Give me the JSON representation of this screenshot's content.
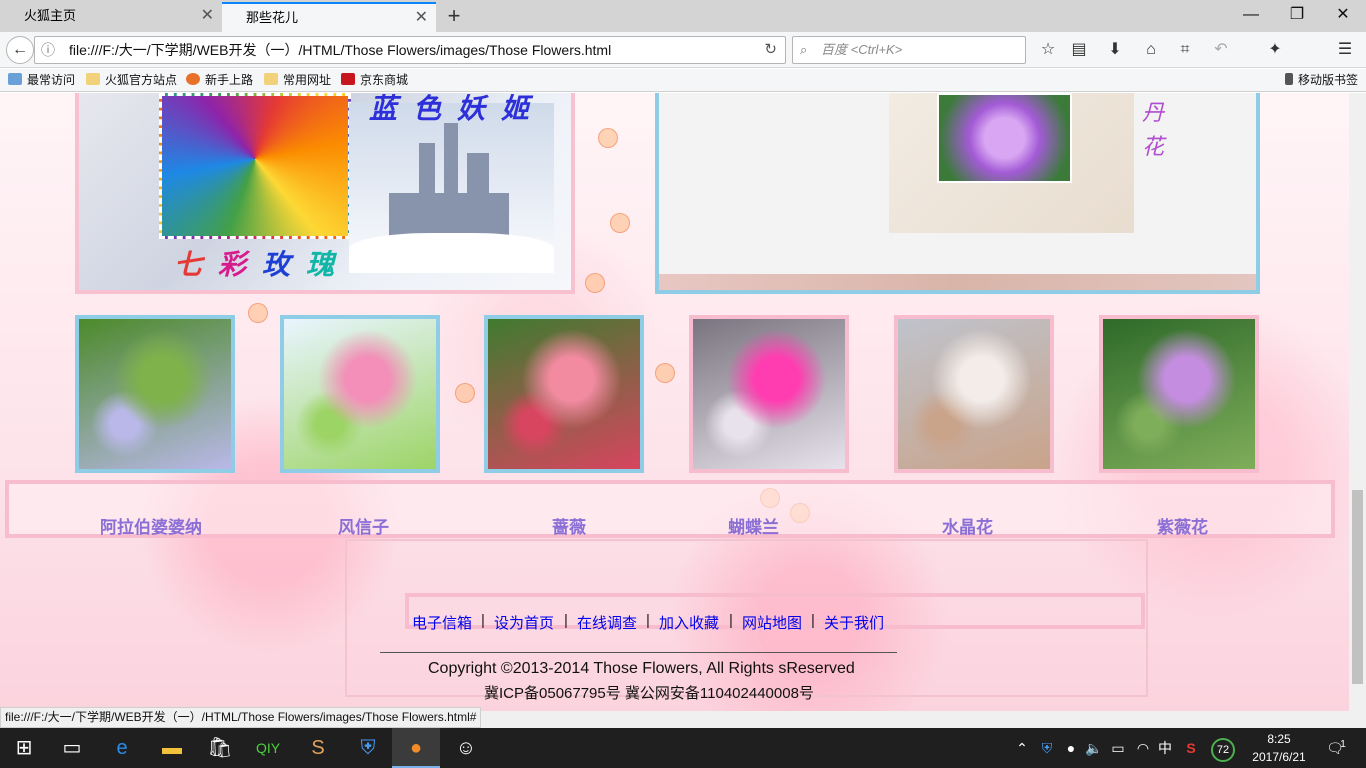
{
  "browser": {
    "tabs": [
      {
        "label": "火狐主页",
        "active": false
      },
      {
        "label": "那些花儿",
        "active": true
      }
    ],
    "url": "file:///F:/大一/下学期/WEB开发（一）/HTML/Those Flowers/images/Those Flowers.html",
    "search_placeholder": "百度 <Ctrl+K>",
    "bookmarks": [
      {
        "label": "最常访问",
        "icon": "star-folder-icon"
      },
      {
        "label": "火狐官方站点",
        "icon": "folder-icon"
      },
      {
        "label": "新手上路",
        "icon": "firefox-icon"
      },
      {
        "label": "常用网址",
        "icon": "folder-icon"
      },
      {
        "label": "京东商城",
        "icon": "jd-icon"
      }
    ],
    "mobile_bookmarks": "移动版书签",
    "status_url": "file:///F:/大一/下学期/WEB开发（一）/HTML/Those Flowers/images/Those Flowers.html#"
  },
  "page": {
    "banner_left": {
      "title_top": "蓝色妖姬",
      "title_bottom_chars": [
        "七",
        "彩",
        "玫",
        "瑰"
      ],
      "title_bottom_colors": [
        "#e53935",
        "#d81b8c",
        "#1e3fd6",
        "#12b6a6"
      ]
    },
    "banner_right": {
      "title_chars": [
        "丹",
        "花"
      ]
    },
    "flowers": [
      {
        "name": "阿拉伯婆婆纳",
        "border": "#8fcde6",
        "colors": [
          "#4c8a2a",
          "#7fb24a",
          "#b9b8e8"
        ]
      },
      {
        "name": "风信子",
        "border": "#8fcde6",
        "colors": [
          "#e9f5ff",
          "#f38fb8",
          "#9dd466"
        ]
      },
      {
        "name": "蔷薇",
        "border": "#8fcde6",
        "colors": [
          "#3f7b2f",
          "#f28aa0",
          "#d7455f"
        ]
      },
      {
        "name": "蝴蝶兰",
        "border": "#f7bccd",
        "colors": [
          "#7a7480",
          "#ff3db0",
          "#e8e2ec"
        ]
      },
      {
        "name": "水晶花",
        "border": "#f7bccd",
        "colors": [
          "#bfc3cc",
          "#f3ece8",
          "#c9a38a"
        ]
      },
      {
        "name": "紫薇花",
        "border": "#f7bccd",
        "colors": [
          "#2f6a2a",
          "#c58de0",
          "#7fae5a"
        ]
      }
    ],
    "footer_links": [
      "电子信箱",
      "设为首页",
      "在线调查",
      "加入收藏",
      "网站地图",
      "关于我们"
    ],
    "copyright": "Copyright ©2013-2014  Those  Flowers, All  Rights sReserved",
    "icp": "冀ICP备05067795号  冀公网安备110402440008号"
  },
  "taskbar": {
    "time": "8:25",
    "date": "2017/6/21",
    "ime": "中",
    "badge": "72",
    "notification_count": "1"
  }
}
